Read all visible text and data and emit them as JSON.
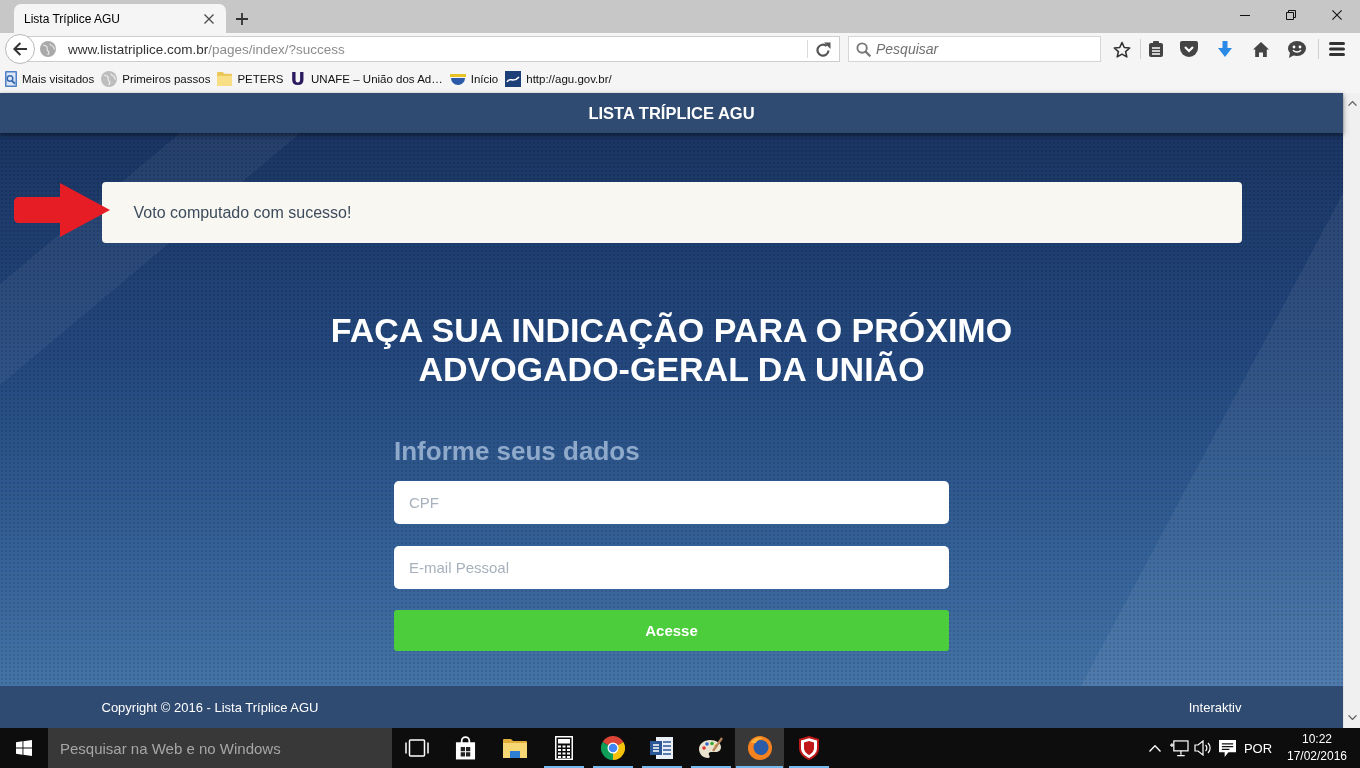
{
  "browser": {
    "tabs": [
      {
        "title": "Lista Tríplice AGU",
        "selected": true
      }
    ],
    "address": {
      "host": "www.listatriplice.com.br",
      "path": "/pages/index/?success"
    },
    "search": {
      "placeholder": "Pesquisar"
    },
    "bookmarks": [
      {
        "kind": "places",
        "label": "Mais visitados"
      },
      {
        "kind": "globe",
        "label": "Primeiros passos"
      },
      {
        "kind": "folder",
        "label": "PETERS"
      },
      {
        "kind": "letter",
        "glyph": "U",
        "label": "UNAFE – União dos Ad…"
      },
      {
        "kind": "emblem",
        "label": "Início"
      },
      {
        "kind": "logo",
        "label": "http://agu.gov.br/"
      }
    ]
  },
  "page": {
    "header": {
      "title": "LISTA TRÍPLICE AGU"
    },
    "alert": {
      "text": "Voto computado com sucesso!"
    },
    "heading": "FAÇA SUA INDICAÇÃO PARA O PRÓXIMO ADVOGADO-GERAL DA UNIÃO",
    "form": {
      "title": "Informe seus dados",
      "fields": [
        {
          "placeholder": "CPF"
        },
        {
          "placeholder": "E-mail Pessoal"
        }
      ],
      "submit": "Acesse"
    },
    "footer": {
      "copyright": "Copyright © 2016 - Lista Tríplice AGU",
      "credit": "Interaktiv"
    }
  },
  "taskbar": {
    "search": {
      "placeholder": "Pesquisar na Web e no Windows"
    },
    "apps": [
      {
        "kind": "taskview",
        "running": false,
        "selected": false
      },
      {
        "kind": "store",
        "running": false,
        "selected": false
      },
      {
        "kind": "files",
        "running": false,
        "selected": false
      },
      {
        "kind": "calculator",
        "running": true,
        "selected": false
      },
      {
        "kind": "ring",
        "running": true,
        "selected": false
      },
      {
        "kind": "document",
        "running": true,
        "selected": false
      },
      {
        "kind": "palette",
        "running": true,
        "selected": false
      },
      {
        "kind": "orb",
        "running": true,
        "selected": true
      },
      {
        "kind": "shield",
        "running": true,
        "selected": false
      }
    ],
    "tray": {
      "language": "POR",
      "time": "10:22",
      "date": "17/02/2016"
    }
  }
}
